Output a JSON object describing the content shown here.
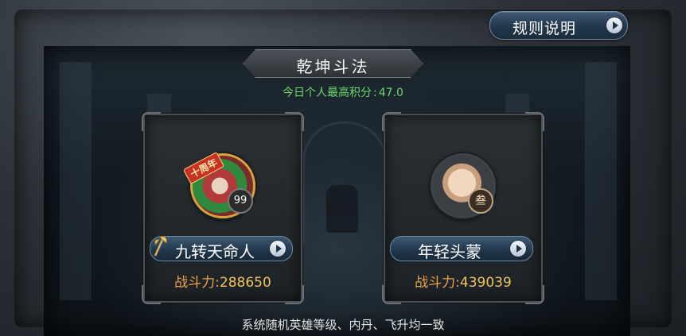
{
  "rules_button": {
    "label": "规则说明",
    "icon": "play-arrow-icon"
  },
  "title": "乾坤斗法",
  "daily_score": {
    "label": "今日个人最高积分",
    "separator": ":",
    "value": "47.0"
  },
  "opponents": [
    {
      "name": "九转天命人",
      "badge": "99",
      "avatar_ribbon": "十周年",
      "weapon_icon": "halberd-icon",
      "power_label": "战斗力",
      "power_separator": ":",
      "power_value": "288650"
    },
    {
      "name": "年轻头蒙",
      "badge": "叁",
      "power_label": "战斗力",
      "power_separator": ":",
      "power_value": "439039"
    }
  ],
  "footer_note": "系统随机英雄等级、内丹、飞升均一致",
  "colors": {
    "score_text": "#6cd86a",
    "power_label": "#f0a24a",
    "power_value": "#f2c25b",
    "button_blue": "#22384b"
  }
}
